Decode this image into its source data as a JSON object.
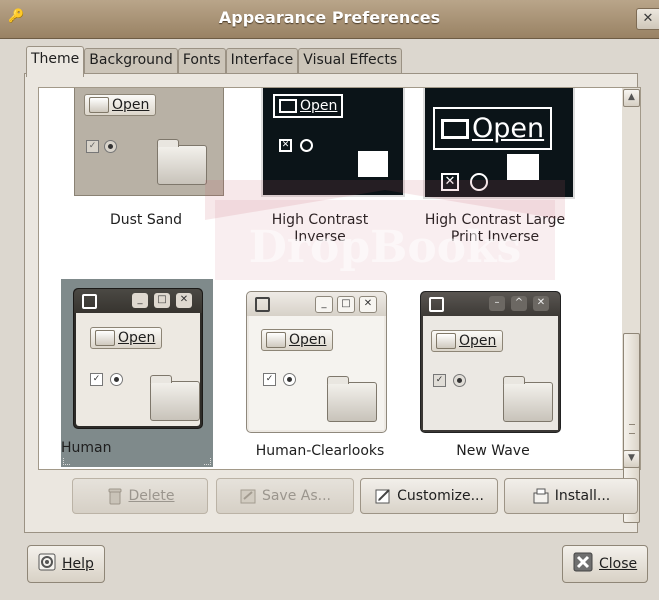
{
  "window": {
    "title": "Appearance Preferences"
  },
  "tabs": [
    {
      "label": "Theme",
      "active": true
    },
    {
      "label": "Background"
    },
    {
      "label": "Fonts"
    },
    {
      "label": "Interface"
    },
    {
      "label": "Visual Effects"
    }
  ],
  "themes": [
    {
      "name": "Dust Sand",
      "preview": {
        "open_label": "Open"
      }
    },
    {
      "name_line1": "High Contrast",
      "name_line2": "Inverse",
      "preview": {
        "open_label": "Open"
      }
    },
    {
      "name_line1": "High Contrast Large",
      "name_line2": "Print Inverse",
      "preview": {
        "open_label": "Open"
      }
    },
    {
      "name": "Human",
      "selected": true,
      "preview": {
        "open_label": "Open"
      }
    },
    {
      "name": "Human-Clearlooks",
      "preview": {
        "open_label": "Open"
      }
    },
    {
      "name": "New Wave",
      "preview": {
        "open_label": "Open"
      }
    }
  ],
  "actions": {
    "delete": {
      "label": "Delete",
      "enabled": false
    },
    "save_as": {
      "label": "Save As...",
      "enabled": false
    },
    "customize": {
      "label": "Customize...",
      "enabled": true
    },
    "install": {
      "label": "Install...",
      "enabled": true
    }
  },
  "footer": {
    "help": "Help",
    "close": "Close"
  },
  "watermark": {
    "text": "DropBooks"
  },
  "colors": {
    "titlebar": "#a8936f",
    "human_window": "#3c3a36",
    "human_selection": "#7f8a8b",
    "clearlooks_bar": "#ede9e3",
    "newwave_bar": "#4a4642",
    "watermark": "#c45a6a"
  }
}
